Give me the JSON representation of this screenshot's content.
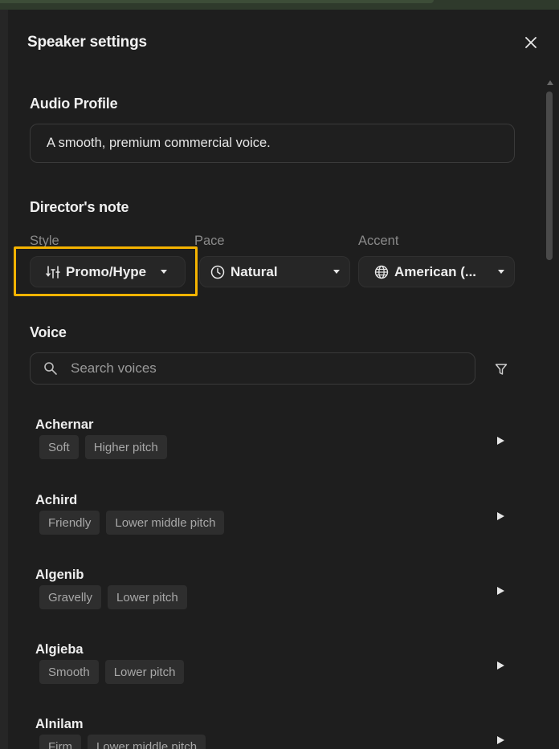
{
  "panel": {
    "title": "Speaker settings"
  },
  "audio_profile": {
    "heading": "Audio Profile",
    "value": "A smooth, premium commercial voice."
  },
  "directors_note": {
    "heading": "Director's note",
    "style": {
      "label": "Style",
      "value": "Promo/Hype",
      "icon": "sliders-icon"
    },
    "pace": {
      "label": "Pace",
      "value": "Natural",
      "icon": "clock-icon"
    },
    "accent": {
      "label": "Accent",
      "value": "American (...",
      "icon": "globe-icon"
    }
  },
  "voice": {
    "heading": "Voice",
    "search_placeholder": "Search voices",
    "items": [
      {
        "name": "Achernar",
        "tags": [
          "Soft",
          "Higher pitch"
        ]
      },
      {
        "name": "Achird",
        "tags": [
          "Friendly",
          "Lower middle pitch"
        ]
      },
      {
        "name": "Algenib",
        "tags": [
          "Gravelly",
          "Lower pitch"
        ]
      },
      {
        "name": "Algieba",
        "tags": [
          "Smooth",
          "Lower pitch"
        ]
      },
      {
        "name": "Alnilam",
        "tags": [
          "Firm",
          "Lower middle pitch"
        ]
      }
    ]
  },
  "colors": {
    "panel_bg": "#1e1e1e",
    "highlight": "#f5b300",
    "tag_bg": "#2e2e2e"
  }
}
